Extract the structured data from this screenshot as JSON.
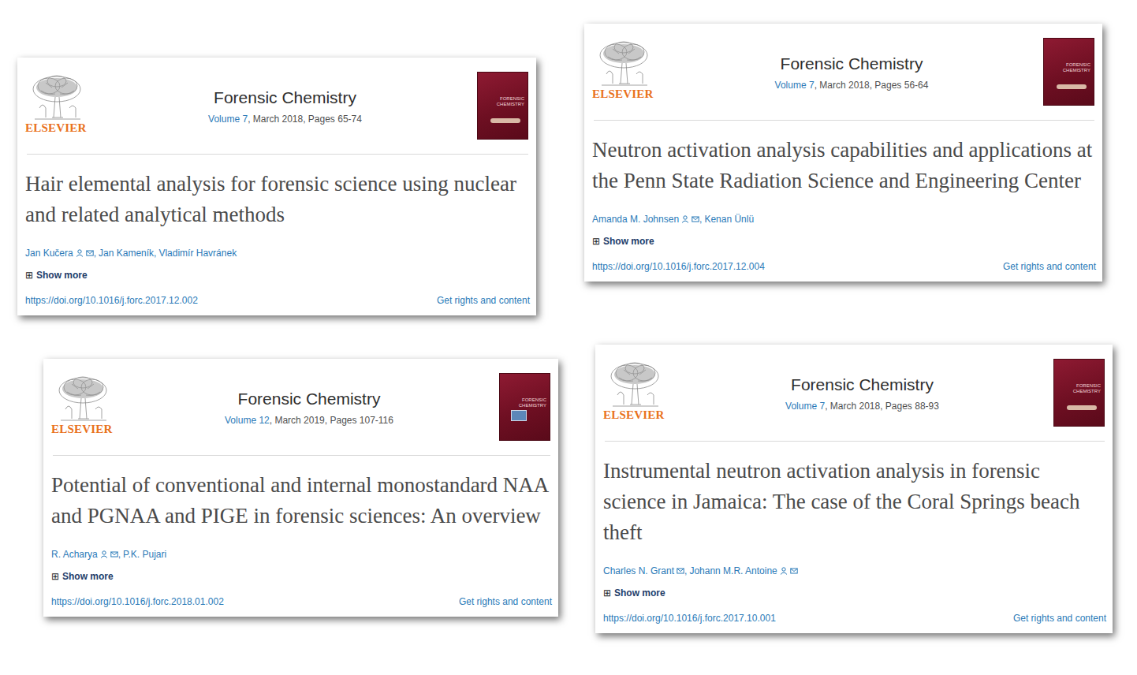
{
  "articles": [
    {
      "publisher": "ELSEVIER",
      "journal": "Forensic Chemistry",
      "cover_text": "FORENSIC CHEMISTRY",
      "volume": "Volume 7",
      "issue_info": ", March 2018, Pages 65-74",
      "title": "Hair elemental analysis for forensic science using nuclear and related analytical methods",
      "authors": [
        {
          "name": "Jan Kučera",
          "corresponding": true,
          "email": true,
          "sep": ","
        },
        {
          "name": "Jan Kameník",
          "corresponding": false,
          "email": false,
          "sep": ","
        },
        {
          "name": "Vladimír Havránek",
          "corresponding": false,
          "email": false,
          "sep": ""
        }
      ],
      "show_more_icon": "⊞",
      "show_more": "Show more",
      "doi": "https://doi.org/10.1016/j.forc.2017.12.002",
      "rights": "Get rights and content"
    },
    {
      "publisher": "ELSEVIER",
      "journal": "Forensic Chemistry",
      "cover_text": "FORENSIC CHEMISTRY",
      "volume": "Volume 7",
      "issue_info": ", March 2018, Pages 56-64",
      "title": "Neutron activation analysis capabilities and applications at the Penn State Radiation Science and Engineering Center",
      "authors": [
        {
          "name": "Amanda M. Johnsen",
          "corresponding": true,
          "email": true,
          "sep": ","
        },
        {
          "name": "Kenan Ünlü",
          "corresponding": false,
          "email": false,
          "sep": ""
        }
      ],
      "show_more_icon": "⊞",
      "show_more": "Show more",
      "doi": "https://doi.org/10.1016/j.forc.2017.12.004",
      "rights": "Get rights and content"
    },
    {
      "publisher": "ELSEVIER",
      "journal": "Forensic Chemistry",
      "cover_text": "FORENSIC CHEMISTRY",
      "volume": "Volume 12",
      "issue_info": ", March 2019, Pages 107-116",
      "title": "Potential of conventional and internal monostandard NAA and PGNAA and PIGE in forensic sciences: An overview",
      "authors": [
        {
          "name": "R. Acharya",
          "corresponding": true,
          "email": true,
          "sep": ","
        },
        {
          "name": "P.K. Pujari",
          "corresponding": false,
          "email": false,
          "sep": ""
        }
      ],
      "show_more_icon": "⊞",
      "show_more": "Show more",
      "doi": "https://doi.org/10.1016/j.forc.2018.01.002",
      "rights": "Get rights and content"
    },
    {
      "publisher": "ELSEVIER",
      "journal": "Forensic Chemistry",
      "cover_text": "FORENSIC CHEMISTRY",
      "volume": "Volume 7",
      "issue_info": ", March 2018, Pages 88-93",
      "title": "Instrumental neutron activation analysis in forensic science in Jamaica: The case of the Coral Springs beach theft",
      "authors": [
        {
          "name": "Charles N. Grant",
          "corresponding": false,
          "email": true,
          "sep": ","
        },
        {
          "name": "Johann M.R. Antoine",
          "corresponding": true,
          "email": true,
          "sep": ""
        }
      ],
      "show_more_icon": "⊞",
      "show_more": "Show more",
      "doi": "https://doi.org/10.1016/j.forc.2017.10.001",
      "rights": "Get rights and content"
    }
  ]
}
